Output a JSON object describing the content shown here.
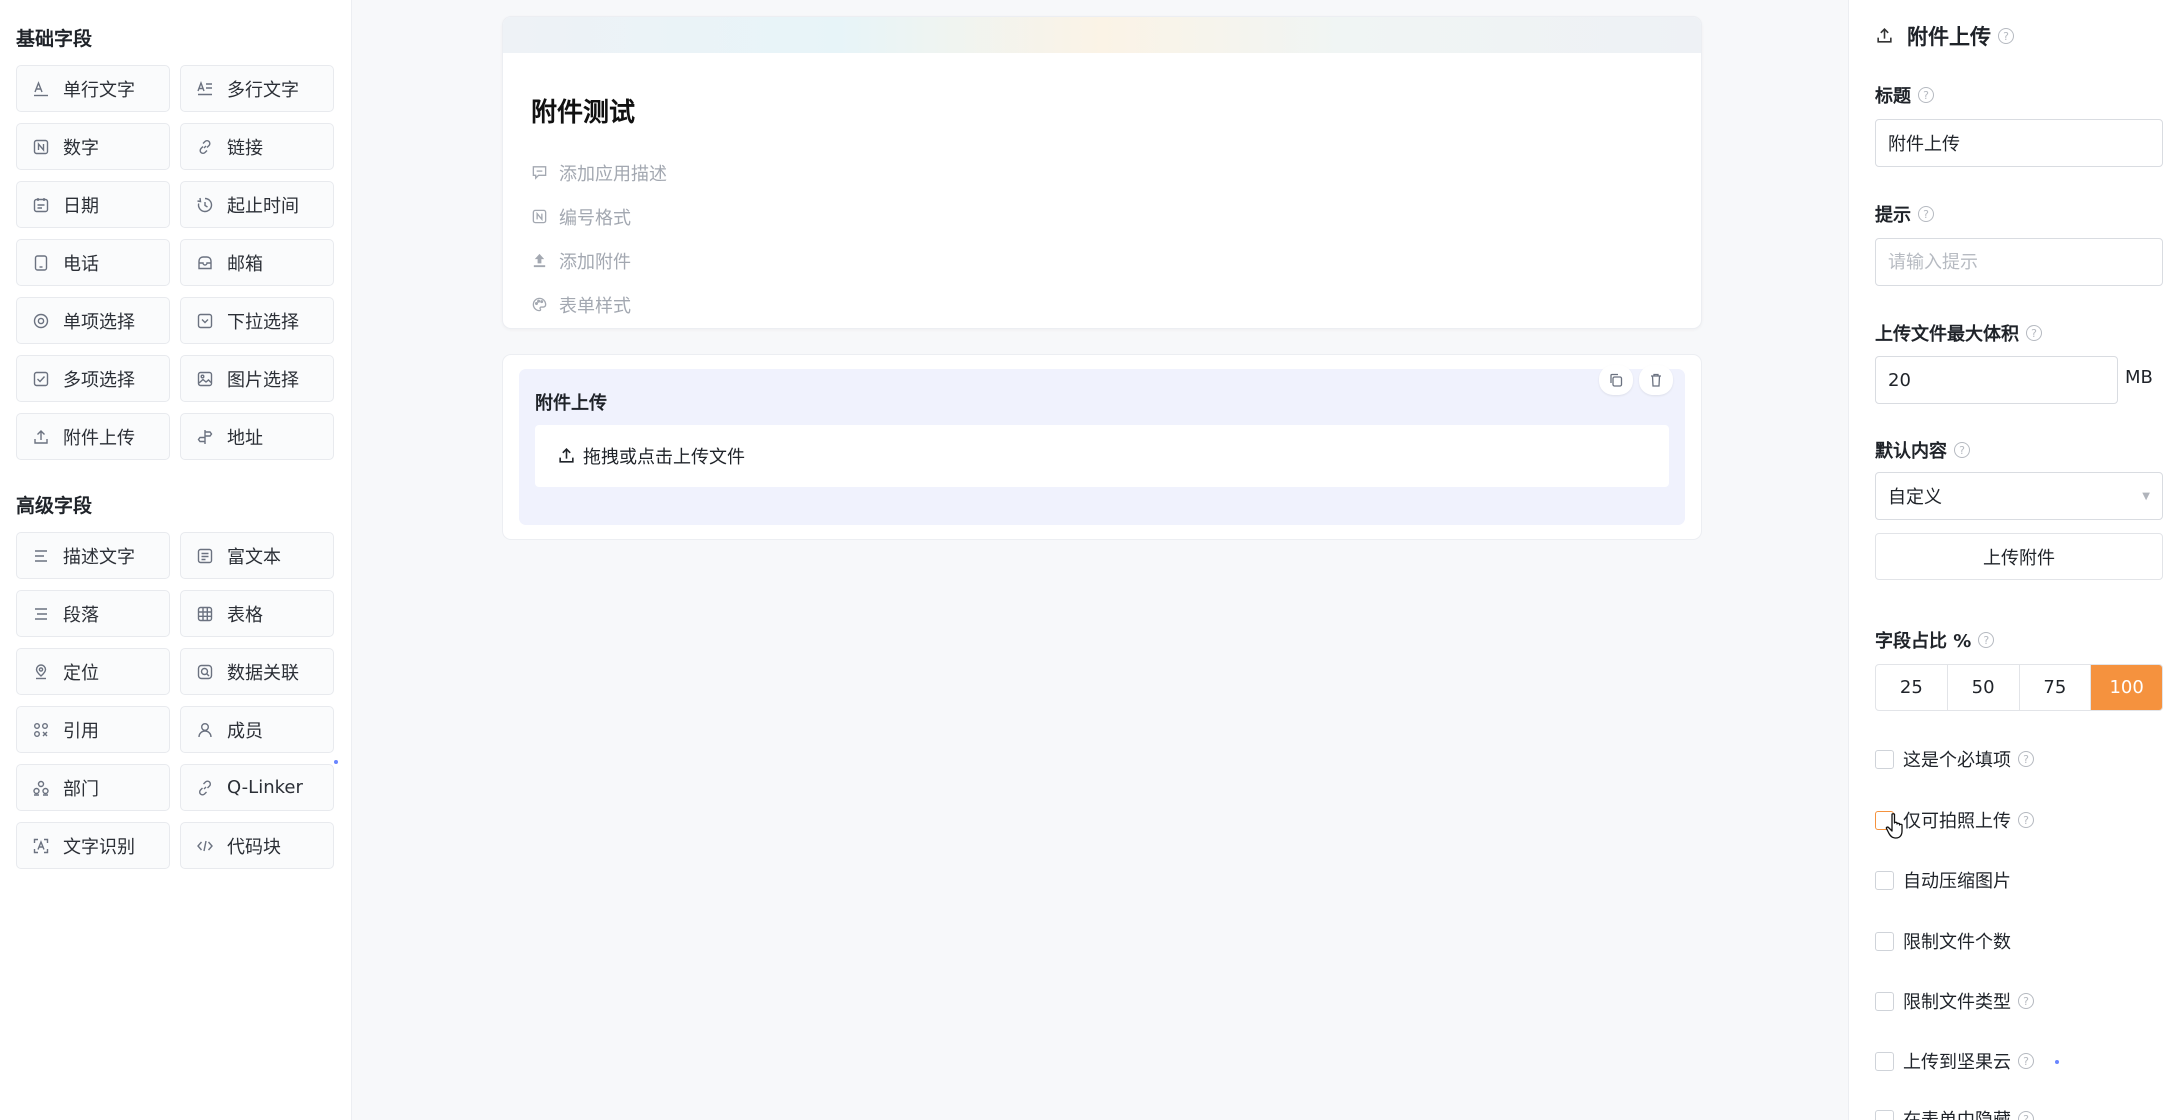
{
  "left_panel": {
    "basic_title": "基础字段",
    "basic_fields": [
      {
        "label": "单行文字",
        "icon": "single-line-text-icon"
      },
      {
        "label": "多行文字",
        "icon": "multi-line-text-icon"
      },
      {
        "label": "数字",
        "icon": "number-icon"
      },
      {
        "label": "链接",
        "icon": "link-icon"
      },
      {
        "label": "日期",
        "icon": "calendar-icon"
      },
      {
        "label": "起止时间",
        "icon": "time-range-icon"
      },
      {
        "label": "电话",
        "icon": "phone-icon"
      },
      {
        "label": "邮箱",
        "icon": "mail-icon"
      },
      {
        "label": "单项选择",
        "icon": "radio-icon"
      },
      {
        "label": "下拉选择",
        "icon": "dropdown-icon"
      },
      {
        "label": "多项选择",
        "icon": "checkbox-icon"
      },
      {
        "label": "图片选择",
        "icon": "image-icon"
      },
      {
        "label": "附件上传",
        "icon": "upload-icon"
      },
      {
        "label": "地址",
        "icon": "address-icon"
      }
    ],
    "advanced_title": "高级字段",
    "advanced_fields": [
      {
        "label": "描述文字",
        "icon": "description-icon"
      },
      {
        "label": "富文本",
        "icon": "rich-text-icon"
      },
      {
        "label": "段落",
        "icon": "paragraph-icon"
      },
      {
        "label": "表格",
        "icon": "table-icon"
      },
      {
        "label": "定位",
        "icon": "location-icon"
      },
      {
        "label": "数据关联",
        "icon": "data-link-icon"
      },
      {
        "label": "引用",
        "icon": "reference-icon"
      },
      {
        "label": "成员",
        "icon": "member-icon"
      },
      {
        "label": "部门",
        "icon": "department-icon"
      },
      {
        "label": "Q-Linker",
        "icon": "q-linker-icon"
      },
      {
        "label": "文字识别",
        "icon": "ocr-icon"
      },
      {
        "label": "代码块",
        "icon": "code-icon"
      }
    ]
  },
  "form_header": {
    "title": "附件测试",
    "add_description": "添加应用描述",
    "number_format": "编号格式",
    "add_attachment": "添加附件",
    "form_style": "表单样式"
  },
  "form_field": {
    "label": "附件上传",
    "upload_hint": "拖拽或点击上传文件"
  },
  "properties": {
    "header": "附件上传",
    "title_label": "标题",
    "title_value": "附件上传",
    "hint_label": "提示",
    "hint_placeholder": "请输入提示",
    "max_size_label": "上传文件最大体积",
    "max_size_value": "20",
    "max_size_unit": "MB",
    "default_label": "默认内容",
    "default_value": "自定义",
    "upload_button": "上传附件",
    "width_label": "字段占比 %",
    "width_options": [
      "25",
      "50",
      "75",
      "100"
    ],
    "width_selected": "100",
    "checkboxes": [
      {
        "label": "这是个必填项",
        "help": true
      },
      {
        "label": "仅可拍照上传",
        "help": true
      },
      {
        "label": "自动压缩图片",
        "help": false
      },
      {
        "label": "限制文件个数",
        "help": false
      },
      {
        "label": "限制文件类型",
        "help": true
      },
      {
        "label": "上传到坚果云",
        "help": true
      },
      {
        "label": "在表单中隐藏",
        "help": true
      }
    ],
    "help_glyph": "?"
  },
  "colors": {
    "accent": "#f5923e",
    "selected_bg": "#f0f2fd",
    "muted_text": "#a3a8b1"
  }
}
